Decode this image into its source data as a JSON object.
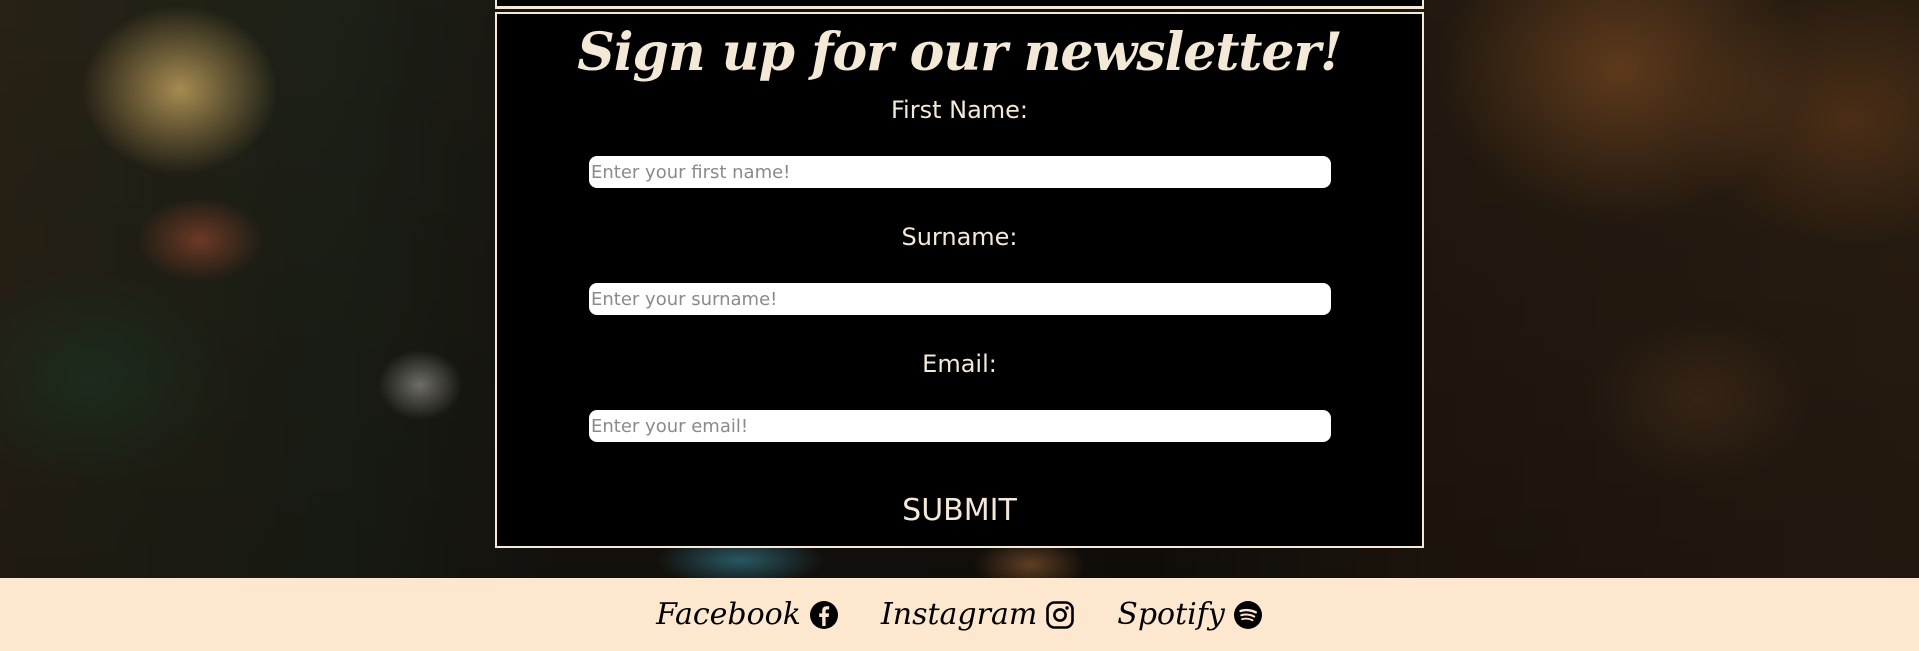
{
  "newsletter": {
    "title": "Sign up for our newsletter!",
    "fields": {
      "first_name": {
        "label": "First Name:",
        "placeholder": "Enter your first name!"
      },
      "surname": {
        "label": "Surname:",
        "placeholder": "Enter your surname!"
      },
      "email": {
        "label": "Email:",
        "placeholder": "Enter your email!"
      }
    },
    "submit_label": "SUBMIT"
  },
  "footer": {
    "links": [
      {
        "label": "Facebook",
        "icon": "facebook-icon"
      },
      {
        "label": "Instagram",
        "icon": "instagram-icon"
      },
      {
        "label": "Spotify",
        "icon": "spotify-icon"
      }
    ]
  },
  "colors": {
    "cream_text": "#f4e9d7",
    "form_background": "#000000",
    "footer_background": "#fde8cf"
  }
}
